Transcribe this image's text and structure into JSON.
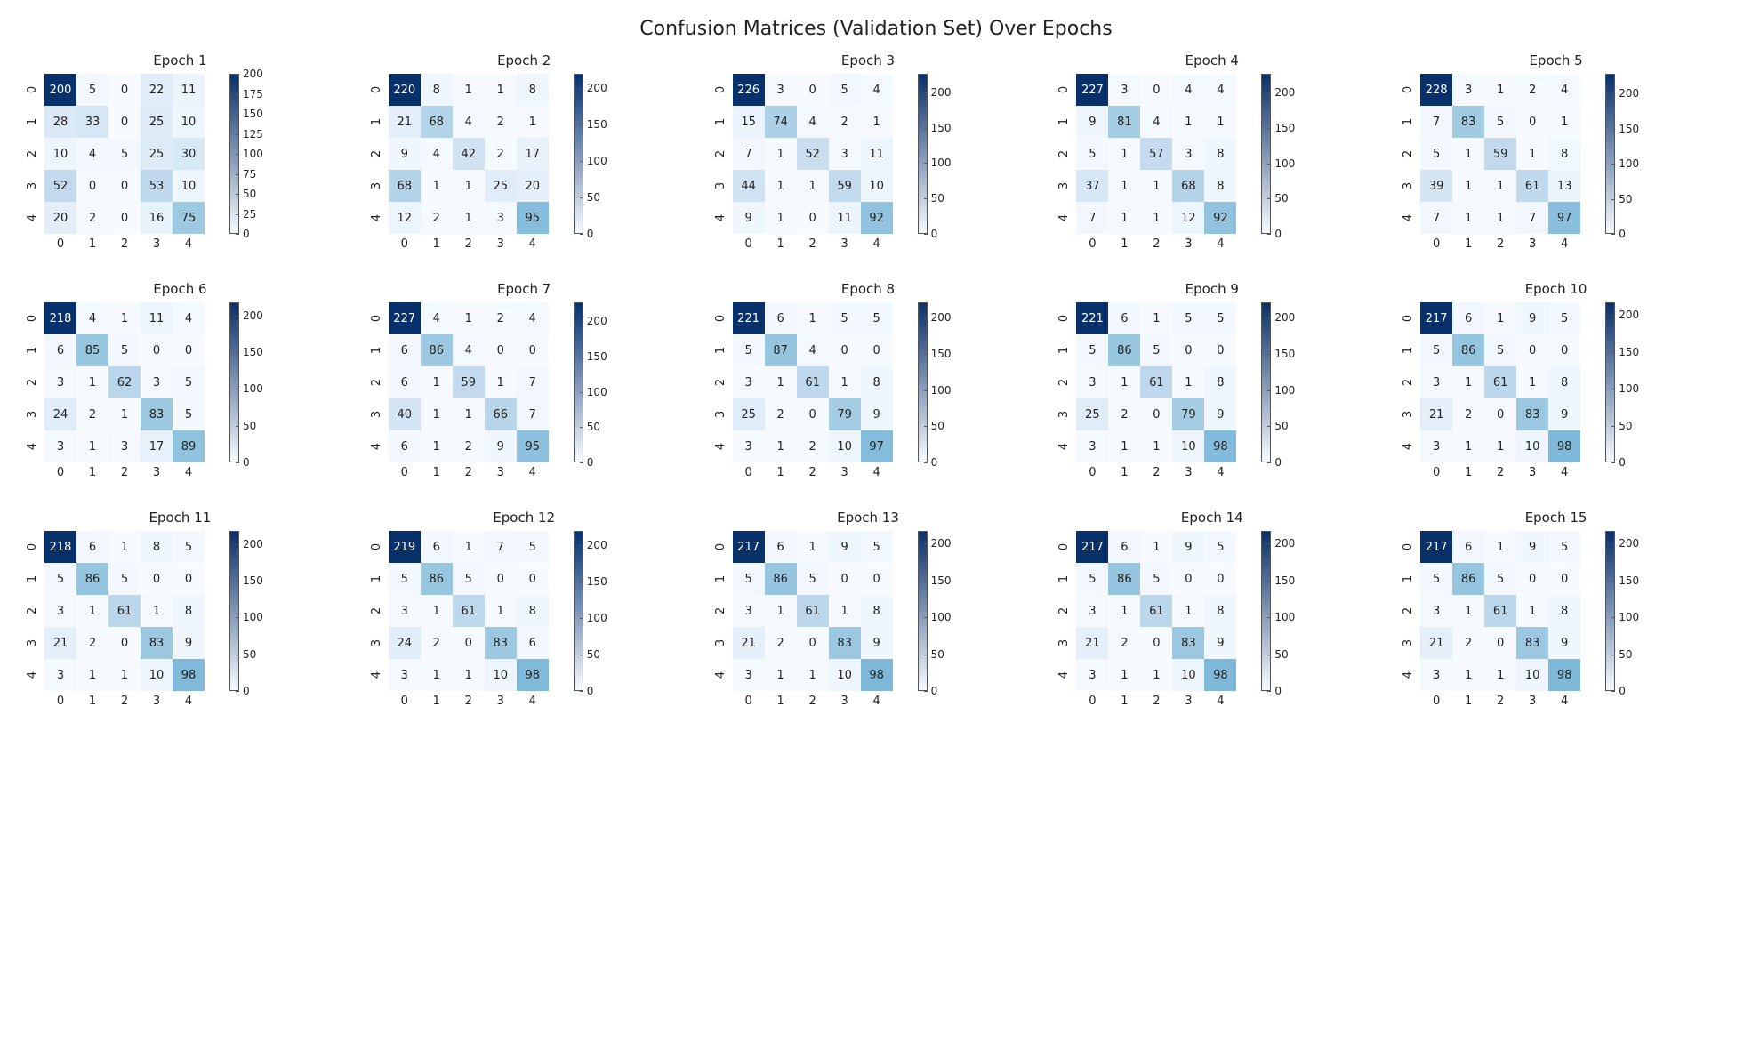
{
  "suptitle": "Confusion Matrices (Validation Set) Over Epochs",
  "class_labels": [
    "0",
    "1",
    "2",
    "3",
    "4"
  ],
  "chart_data": [
    {
      "type": "heatmap",
      "title": "Epoch 1",
      "matrix": [
        [
          200,
          5,
          0,
          22,
          11
        ],
        [
          28,
          33,
          0,
          25,
          10
        ],
        [
          10,
          4,
          5,
          25,
          30
        ],
        [
          52,
          0,
          0,
          53,
          10
        ],
        [
          20,
          2,
          0,
          16,
          75
        ]
      ],
      "vmax": 200,
      "cbar_ticks": [
        0,
        25,
        50,
        75,
        100,
        125,
        150,
        175,
        200
      ]
    },
    {
      "type": "heatmap",
      "title": "Epoch 2",
      "matrix": [
        [
          220,
          8,
          1,
          1,
          8
        ],
        [
          21,
          68,
          4,
          2,
          1
        ],
        [
          9,
          4,
          42,
          2,
          17
        ],
        [
          68,
          1,
          1,
          25,
          20
        ],
        [
          12,
          2,
          1,
          3,
          95
        ]
      ],
      "vmax": 220,
      "cbar_ticks": [
        0,
        50,
        100,
        150,
        200
      ]
    },
    {
      "type": "heatmap",
      "title": "Epoch 3",
      "matrix": [
        [
          226,
          3,
          0,
          5,
          4
        ],
        [
          15,
          74,
          4,
          2,
          1
        ],
        [
          7,
          1,
          52,
          3,
          11
        ],
        [
          44,
          1,
          1,
          59,
          10
        ],
        [
          9,
          1,
          0,
          11,
          92
        ]
      ],
      "vmax": 226,
      "cbar_ticks": [
        0,
        50,
        100,
        150,
        200
      ]
    },
    {
      "type": "heatmap",
      "title": "Epoch 4",
      "matrix": [
        [
          227,
          3,
          0,
          4,
          4
        ],
        [
          9,
          81,
          4,
          1,
          1
        ],
        [
          5,
          1,
          57,
          3,
          8
        ],
        [
          37,
          1,
          1,
          68,
          8
        ],
        [
          7,
          1,
          1,
          12,
          92
        ]
      ],
      "vmax": 227,
      "cbar_ticks": [
        0,
        50,
        100,
        150,
        200
      ]
    },
    {
      "type": "heatmap",
      "title": "Epoch 5",
      "matrix": [
        [
          228,
          3,
          1,
          2,
          4
        ],
        [
          7,
          83,
          5,
          0,
          1
        ],
        [
          5,
          1,
          59,
          1,
          8
        ],
        [
          39,
          1,
          1,
          61,
          13
        ],
        [
          7,
          1,
          1,
          7,
          97
        ]
      ],
      "vmax": 228,
      "cbar_ticks": [
        0,
        50,
        100,
        150,
        200
      ]
    },
    {
      "type": "heatmap",
      "title": "Epoch 6",
      "matrix": [
        [
          218,
          4,
          1,
          11,
          4
        ],
        [
          6,
          85,
          5,
          0,
          0
        ],
        [
          3,
          1,
          62,
          3,
          5
        ],
        [
          24,
          2,
          1,
          83,
          5
        ],
        [
          3,
          1,
          3,
          17,
          89
        ]
      ],
      "vmax": 218,
      "cbar_ticks": [
        0,
        50,
        100,
        150,
        200
      ]
    },
    {
      "type": "heatmap",
      "title": "Epoch 7",
      "matrix": [
        [
          227,
          4,
          1,
          2,
          4
        ],
        [
          6,
          86,
          4,
          0,
          0
        ],
        [
          6,
          1,
          59,
          1,
          7
        ],
        [
          40,
          1,
          1,
          66,
          7
        ],
        [
          6,
          1,
          2,
          9,
          95
        ]
      ],
      "vmax": 227,
      "cbar_ticks": [
        0,
        50,
        100,
        150,
        200
      ]
    },
    {
      "type": "heatmap",
      "title": "Epoch 8",
      "matrix": [
        [
          221,
          6,
          1,
          5,
          5
        ],
        [
          5,
          87,
          4,
          0,
          0
        ],
        [
          3,
          1,
          61,
          1,
          8
        ],
        [
          25,
          2,
          0,
          79,
          9
        ],
        [
          3,
          1,
          2,
          10,
          97
        ]
      ],
      "vmax": 221,
      "cbar_ticks": [
        0,
        50,
        100,
        150,
        200
      ]
    },
    {
      "type": "heatmap",
      "title": "Epoch 9",
      "matrix": [
        [
          221,
          6,
          1,
          5,
          5
        ],
        [
          5,
          86,
          5,
          0,
          0
        ],
        [
          3,
          1,
          61,
          1,
          8
        ],
        [
          25,
          2,
          0,
          79,
          9
        ],
        [
          3,
          1,
          1,
          10,
          98
        ]
      ],
      "vmax": 221,
      "cbar_ticks": [
        0,
        50,
        100,
        150,
        200
      ]
    },
    {
      "type": "heatmap",
      "title": "Epoch 10",
      "matrix": [
        [
          217,
          6,
          1,
          9,
          5
        ],
        [
          5,
          86,
          5,
          0,
          0
        ],
        [
          3,
          1,
          61,
          1,
          8
        ],
        [
          21,
          2,
          0,
          83,
          9
        ],
        [
          3,
          1,
          1,
          10,
          98
        ]
      ],
      "vmax": 217,
      "cbar_ticks": [
        0,
        50,
        100,
        150,
        200
      ]
    },
    {
      "type": "heatmap",
      "title": "Epoch 11",
      "matrix": [
        [
          218,
          6,
          1,
          8,
          5
        ],
        [
          5,
          86,
          5,
          0,
          0
        ],
        [
          3,
          1,
          61,
          1,
          8
        ],
        [
          21,
          2,
          0,
          83,
          9
        ],
        [
          3,
          1,
          1,
          10,
          98
        ]
      ],
      "vmax": 218,
      "cbar_ticks": [
        0,
        50,
        100,
        150,
        200
      ]
    },
    {
      "type": "heatmap",
      "title": "Epoch 12",
      "matrix": [
        [
          219,
          6,
          1,
          7,
          5
        ],
        [
          5,
          86,
          5,
          0,
          0
        ],
        [
          3,
          1,
          61,
          1,
          8
        ],
        [
          24,
          2,
          0,
          83,
          6
        ],
        [
          3,
          1,
          1,
          10,
          98
        ]
      ],
      "vmax": 219,
      "cbar_ticks": [
        0,
        50,
        100,
        150,
        200
      ]
    },
    {
      "type": "heatmap",
      "title": "Epoch 13",
      "matrix": [
        [
          217,
          6,
          1,
          9,
          5
        ],
        [
          5,
          86,
          5,
          0,
          0
        ],
        [
          3,
          1,
          61,
          1,
          8
        ],
        [
          21,
          2,
          0,
          83,
          9
        ],
        [
          3,
          1,
          1,
          10,
          98
        ]
      ],
      "vmax": 217,
      "cbar_ticks": [
        0,
        50,
        100,
        150,
        200
      ]
    },
    {
      "type": "heatmap",
      "title": "Epoch 14",
      "matrix": [
        [
          217,
          6,
          1,
          9,
          5
        ],
        [
          5,
          86,
          5,
          0,
          0
        ],
        [
          3,
          1,
          61,
          1,
          8
        ],
        [
          21,
          2,
          0,
          83,
          9
        ],
        [
          3,
          1,
          1,
          10,
          98
        ]
      ],
      "vmax": 217,
      "cbar_ticks": [
        0,
        50,
        100,
        150,
        200
      ]
    },
    {
      "type": "heatmap",
      "title": "Epoch 15",
      "matrix": [
        [
          217,
          6,
          1,
          9,
          5
        ],
        [
          5,
          86,
          5,
          0,
          0
        ],
        [
          3,
          1,
          61,
          1,
          8
        ],
        [
          21,
          2,
          0,
          83,
          9
        ],
        [
          3,
          1,
          1,
          10,
          98
        ]
      ],
      "vmax": 217,
      "cbar_ticks": [
        0,
        50,
        100,
        150,
        200
      ]
    }
  ]
}
